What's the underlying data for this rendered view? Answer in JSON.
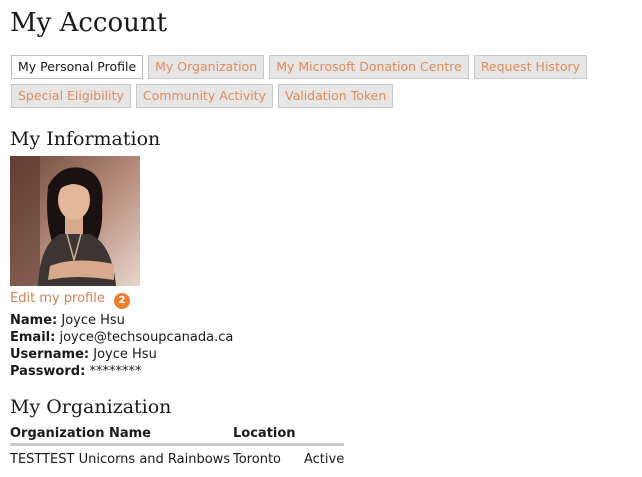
{
  "page": {
    "title": "My Account"
  },
  "tabs": {
    "row1": [
      {
        "label": "My Personal Profile",
        "active": true
      },
      {
        "label": "My Organization",
        "active": false
      },
      {
        "label": "My Microsoft Donation Centre",
        "active": false
      },
      {
        "label": "Request History",
        "active": false
      }
    ],
    "row2": [
      {
        "label": "Special Eligibility",
        "active": false
      },
      {
        "label": "Community Activity",
        "active": false
      },
      {
        "label": "Validation Token",
        "active": false
      }
    ]
  },
  "info_section": {
    "title": "My Information",
    "edit_link": "Edit my profile",
    "badge": "2",
    "name_label": "Name:",
    "name_value": "Joyce Hsu",
    "email_label": "Email:",
    "email_value": "joyce@techsoupcanada.ca",
    "username_label": "Username:",
    "username_value": "Joyce Hsu",
    "password_label": "Password:",
    "password_value": "********"
  },
  "org_section": {
    "title": "My Organization",
    "columns": [
      "Organization Name",
      "Location",
      ""
    ],
    "rows": [
      [
        "TESTTEST Unicorns and Rainbows",
        "Toronto",
        "Active"
      ]
    ]
  },
  "colors": {
    "link": "#d8834f",
    "tab_bg": "#e6e6e6",
    "badge": "#ef7d2a"
  }
}
